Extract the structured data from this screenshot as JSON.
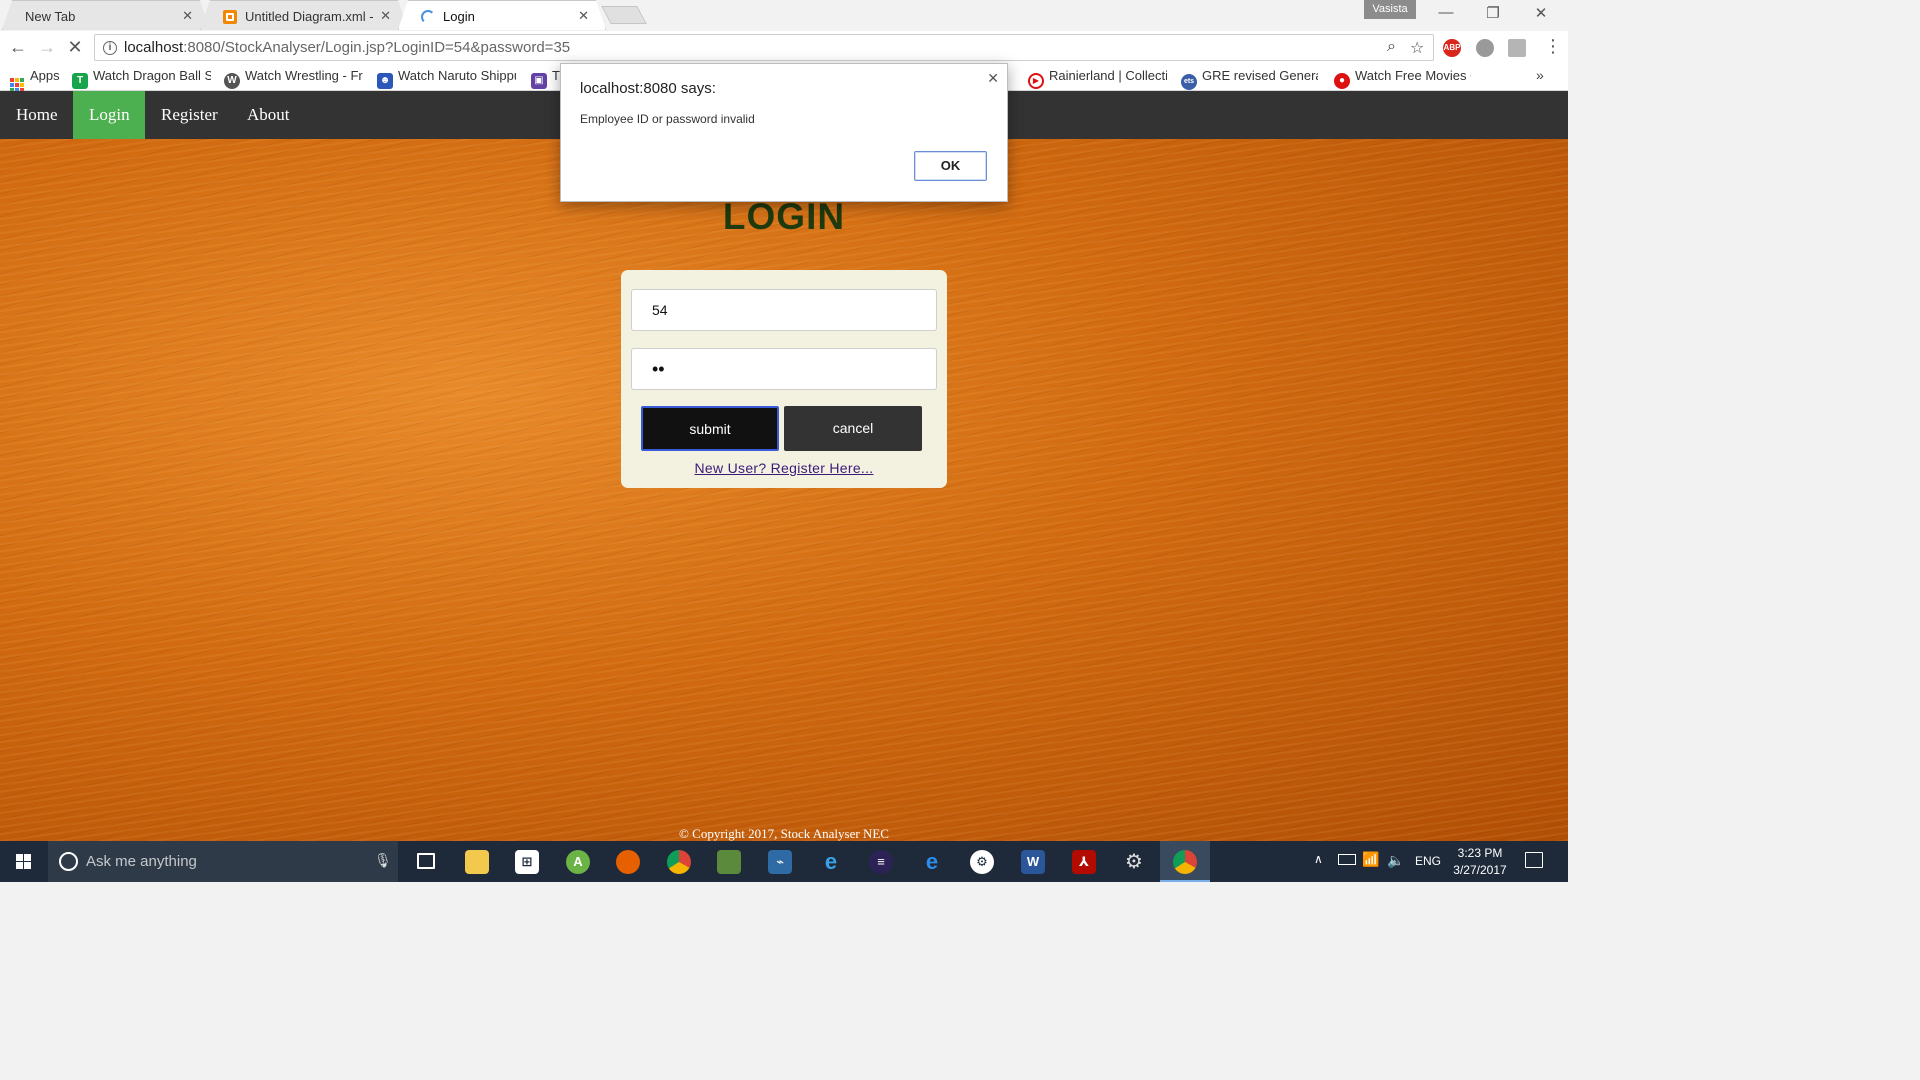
{
  "browser": {
    "tabs": [
      {
        "title": "New Tab",
        "active": false
      },
      {
        "title": "Untitled Diagram.xml - d",
        "active": false
      },
      {
        "title": "Login",
        "active": true
      }
    ],
    "profile_name": "Vasista",
    "url_host": "localhost",
    "url_path": ":8080/StockAnalyser/Login.jsp?LoginID=54&password=35",
    "ext_abp_label": "ABP",
    "bookmarks": [
      {
        "label": "Apps",
        "icon": "apps-grid-icon"
      },
      {
        "label": "Watch Dragon Ball Su",
        "icon": "tv-icon"
      },
      {
        "label": "Watch Wrestling - Fre",
        "icon": "wordpress-icon"
      },
      {
        "label": "Watch Naruto Shippu",
        "icon": "people-icon"
      },
      {
        "label": "T",
        "icon": "twitch-icon"
      },
      {
        "label": "Rainierland | Collectio",
        "icon": "play-icon"
      },
      {
        "label": "GRE revised General T",
        "icon": "ets-icon"
      },
      {
        "label": "Watch Free Movies O",
        "icon": "movie-icon"
      }
    ],
    "bookmarks_more": "»"
  },
  "site": {
    "nav": [
      {
        "label": "Home",
        "active": false
      },
      {
        "label": "Login",
        "active": true
      },
      {
        "label": "Register",
        "active": false
      },
      {
        "label": "About",
        "active": false
      }
    ],
    "login_title": "LOGIN",
    "employee_id_value": "54",
    "password_mask": "••",
    "submit_label": "submit",
    "cancel_label": "cancel",
    "register_link": "New User? Register Here...",
    "footer": "© Copyright 2017, Stock Analyser NEC"
  },
  "alert": {
    "title": "localhost:8080 says:",
    "message": "Employee ID or password invalid",
    "ok_label": "OK"
  },
  "taskbar": {
    "search_placeholder": "Ask me anything",
    "language": "ENG",
    "time": "3:23 PM",
    "date": "3/27/2017"
  },
  "colors": {
    "nav_active": "#4caf50",
    "nav_bg": "#333333",
    "login_title": "#1f3a0e",
    "card_bg": "#f3f1e0",
    "taskbar_bg": "#1e2a3a"
  }
}
